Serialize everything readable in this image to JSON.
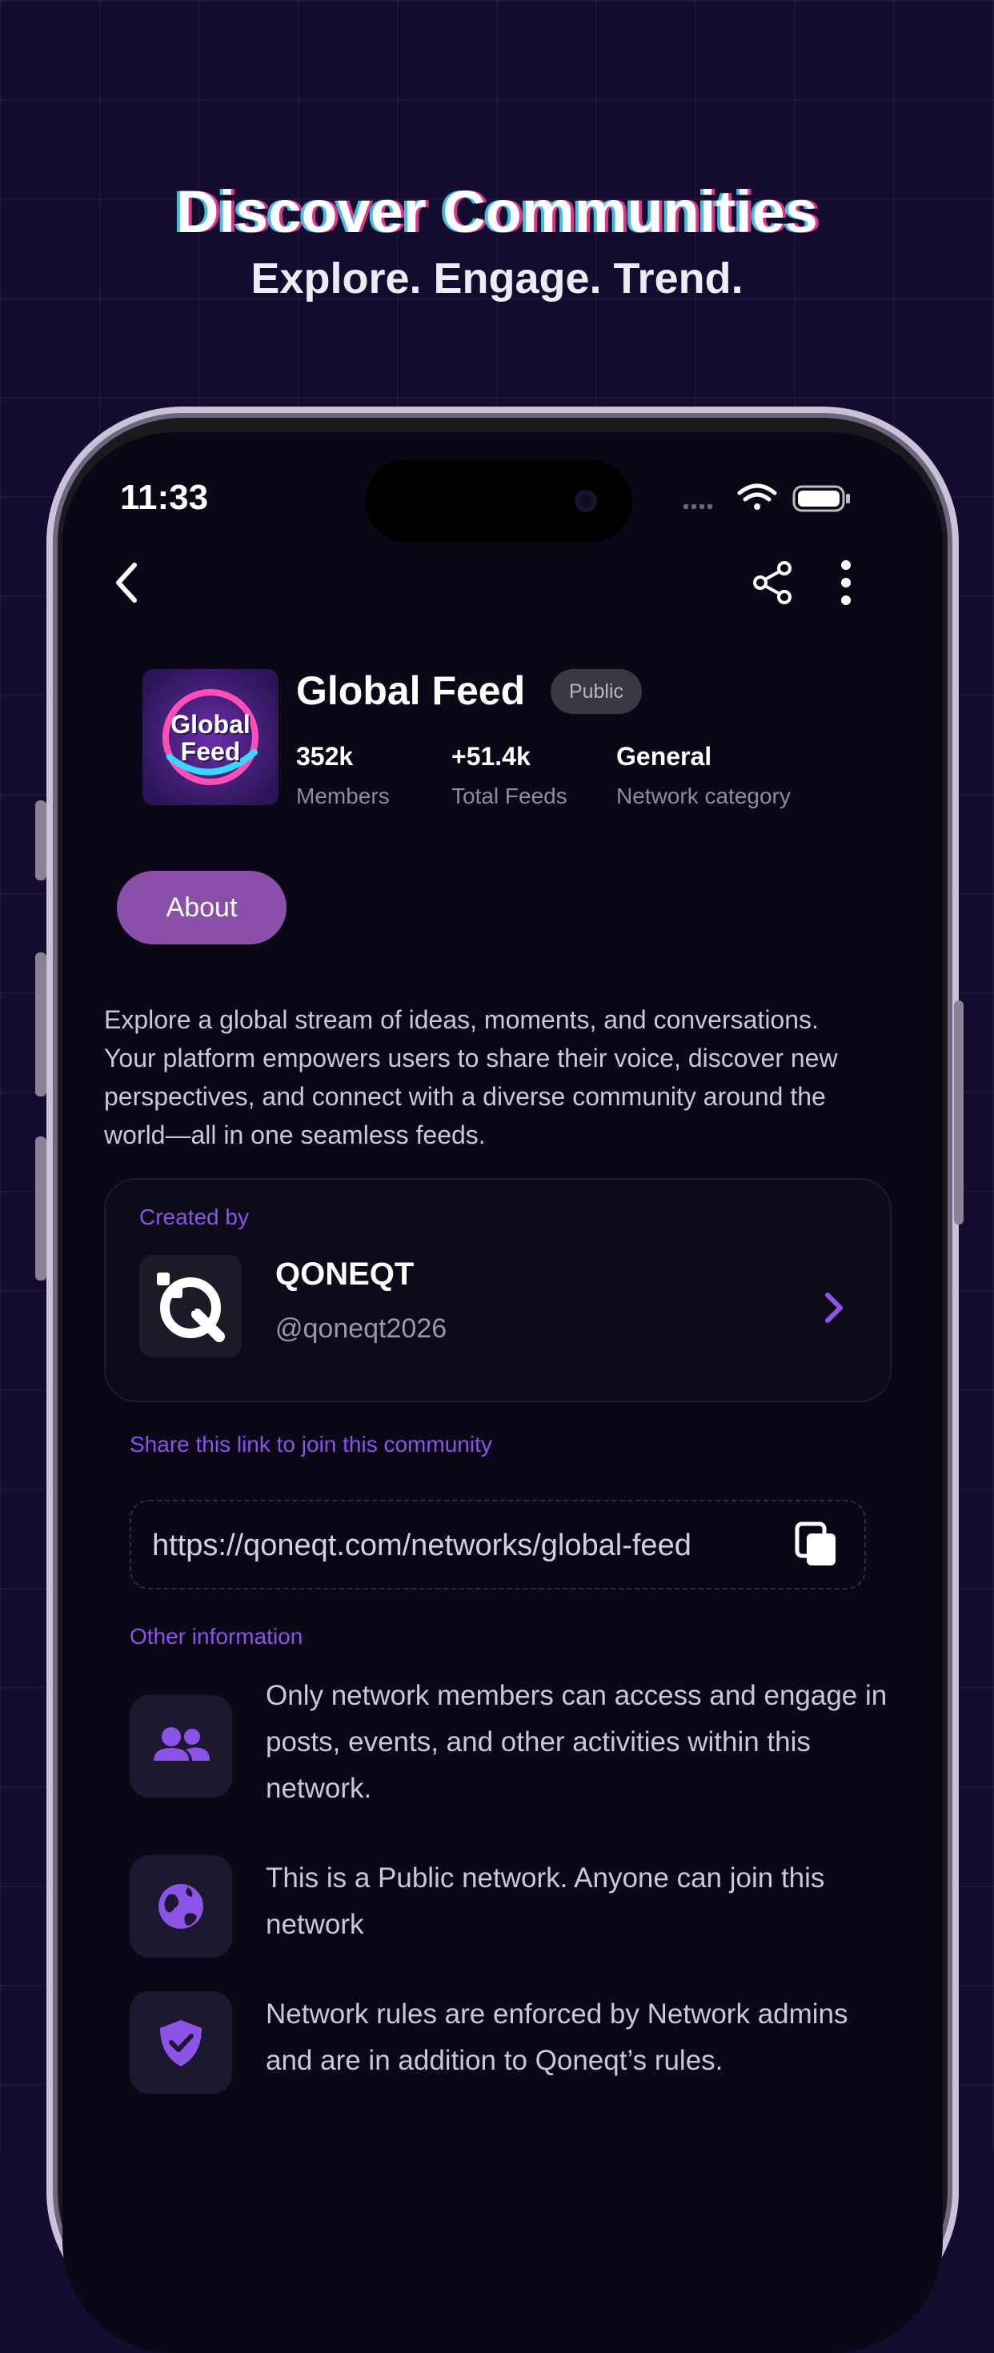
{
  "hero": {
    "title": "Discover Communities",
    "subtitle": "Explore. Engage. Trend."
  },
  "status_bar": {
    "time": "11:33",
    "icons": [
      "signal-icon",
      "wifi-icon",
      "battery-icon"
    ]
  },
  "header": {
    "icons": [
      "back-chevron-icon",
      "share-icon",
      "more-vertical-icon"
    ]
  },
  "community": {
    "name": "Global Feed",
    "visibility_badge": "Public",
    "logo_text_line1": "Global",
    "logo_text_line2": "Feed",
    "stats": [
      {
        "value": "352k",
        "label": "Members"
      },
      {
        "value": "+51.4k",
        "label": "Total Feeds"
      },
      {
        "value": "General",
        "label": "Network category"
      }
    ]
  },
  "tabs": {
    "about_label": "About"
  },
  "description": "Explore a global stream of ideas, moments, and conversations. Your platform empowers users to share their voice, discover new perspectives, and connect with a diverse community around the world—all in one seamless feeds.",
  "creator": {
    "section_label": "Created by",
    "name": "QONEQT",
    "handle": "@qoneqt2026"
  },
  "share": {
    "label": "Share this link to join this community",
    "url": "https://qoneqt.com/networks/global-feed"
  },
  "other_info": {
    "label": "Other information",
    "items": [
      {
        "icon": "users-icon",
        "text": "Only network members can access and engage in posts, events, and other activities within this network."
      },
      {
        "icon": "globe-icon",
        "text": "This is a Public network. Anyone can join this network"
      },
      {
        "icon": "shield-check-icon",
        "text": "Network rules are enforced by Network admins and are in addition to Qoneqt’s rules."
      }
    ]
  },
  "colors": {
    "background": "#140c2e",
    "screen": "#0b0716",
    "accent_purple": "#8b54e6",
    "about_button": "#8a4fa8"
  }
}
